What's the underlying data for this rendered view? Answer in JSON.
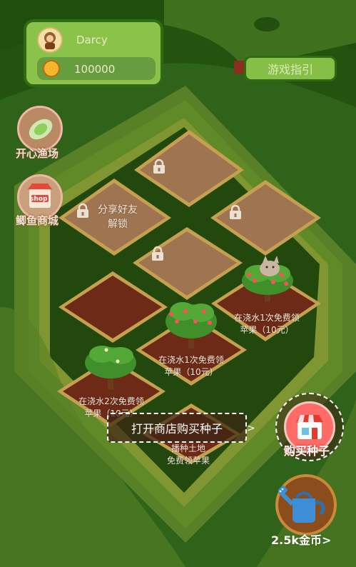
{
  "profile": {
    "username": "Darcy",
    "coins": "100000"
  },
  "header": {
    "guide_label": "游戏指引"
  },
  "sidebar": {
    "fishing_label": "开心渔场",
    "squid_shop_label": "鲫鱼商城",
    "shop_icon_text": "shop"
  },
  "plots": {
    "share_unlock_line1": "分享好友",
    "share_unlock_line2": "解锁",
    "tree1_line1": "在浇水1次免费领",
    "tree1_line2": "苹果（10元）",
    "tree2_line1": "在浇水1次免费领",
    "tree2_line2": "苹果（10元）",
    "tree3_line1": "在浇水2次免费领",
    "tree3_line2": "苹果（10元）",
    "empty_line1": "播种土地",
    "empty_line2": "免费领苹果"
  },
  "tooltip": {
    "text": "打开商店购买种子",
    "arrow": ">"
  },
  "actions": {
    "buy_seeds_label": "购买种子",
    "watering_label": "2.5k金币>"
  },
  "colors": {
    "grass": "#3e7f22",
    "soil": "#6d2a16",
    "locked_soil": "#9f7451",
    "accent": "#f35c3a"
  },
  "icons": [
    "avatar-icon",
    "coin-icon",
    "lettuce-icon",
    "shop-icon",
    "lock-icon",
    "apple-tree-icon",
    "cat-icon",
    "store-icon",
    "watering-can-icon"
  ]
}
